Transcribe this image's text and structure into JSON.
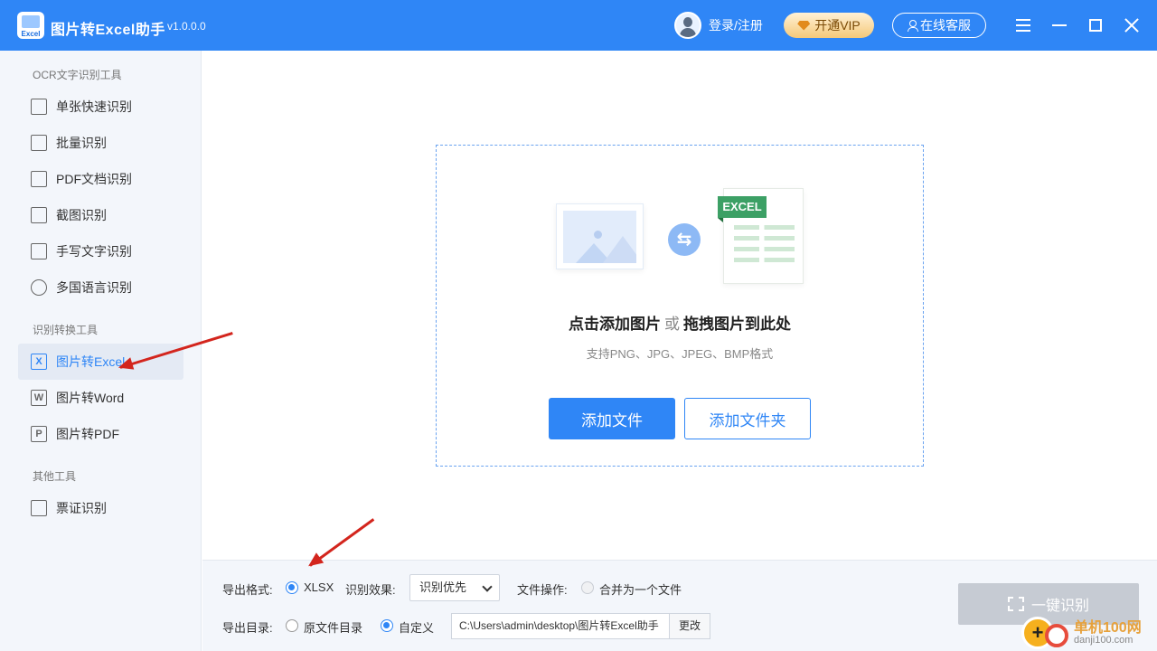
{
  "titlebar": {
    "app_title": "图片转Excel助手",
    "version": "v1.0.0.0",
    "logo_text": "Excel",
    "login": "登录/注册",
    "vip": "开通VIP",
    "service": "在线客服"
  },
  "sidebar": {
    "section1": "OCR文字识别工具",
    "items1": [
      {
        "label": "单张快速识别",
        "icon": "image-scan-icon"
      },
      {
        "label": "批量识别",
        "icon": "stack-icon"
      },
      {
        "label": "PDF文档识别",
        "icon": "pdf-icon"
      },
      {
        "label": "截图识别",
        "icon": "crop-icon"
      },
      {
        "label": "手写文字识别",
        "icon": "pen-icon"
      },
      {
        "label": "多国语言识别",
        "icon": "globe-icon"
      }
    ],
    "section2": "识别转换工具",
    "items2": [
      {
        "label": "图片转Excel",
        "icon": "excel-icon",
        "glyph": "X"
      },
      {
        "label": "图片转Word",
        "icon": "word-icon",
        "glyph": "W"
      },
      {
        "label": "图片转PDF",
        "icon": "pdf-file-icon",
        "glyph": "P"
      }
    ],
    "section3": "其他工具",
    "items3": [
      {
        "label": "票证识别",
        "icon": "ticket-icon"
      }
    ]
  },
  "dropzone": {
    "excel_badge": "EXCEL",
    "title_click": "点击添加图片",
    "title_or": "或",
    "title_drag": "拖拽图片到此处",
    "subtitle": "支持PNG、JPG、JPEG、BMP格式",
    "add_file": "添加文件",
    "add_folder": "添加文件夹"
  },
  "options": {
    "export_format_label": "导出格式:",
    "format_value": "XLSX",
    "effect_label": "识别效果:",
    "effect_value": "识别优先",
    "file_op_label": "文件操作:",
    "merge_label": "合并为一个文件",
    "export_dir_label": "导出目录:",
    "dir_original": "原文件目录",
    "dir_custom": "自定义",
    "path": "C:\\Users\\admin\\desktop\\图片转Excel助手",
    "change": "更改",
    "recognize": "一键识别"
  },
  "watermark": {
    "site_name": "单机100网",
    "site_url": "danji100.com"
  },
  "colors": {
    "accent": "#2f86f6",
    "excel_green": "#3ca065",
    "arrow_red": "#d3251d"
  }
}
